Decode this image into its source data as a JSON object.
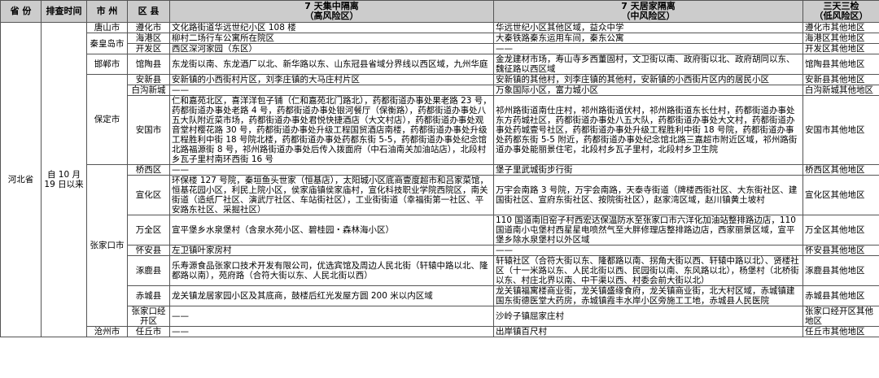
{
  "header": {
    "province": "省 份",
    "date": "排查时间",
    "city": "市 州",
    "county": "区 县",
    "col7_title": "7 天集中隔离",
    "col7_sub": "（高风险区）",
    "col7h_title": "7 天居家隔离",
    "col7h_sub": "（中风险区）",
    "col3_title": "三天三检",
    "col3_sub": "（低风险区）"
  },
  "province": "河北省",
  "date": "自 10 月 19 日以来",
  "cities": {
    "tangshan": "唐山市",
    "qinhuangdao": "秦皇岛市",
    "handan": "邯郸市",
    "baoding": "保定市",
    "zhangjiakou": "张家口市",
    "cangzhou": "沧州市"
  },
  "rows": [
    {
      "county": "遵化市",
      "high": "文化路街道华远世纪小区 108 楼",
      "mid": "华远世纪小区其他区域，益众中学",
      "low": "遵化市其他地区"
    },
    {
      "county": "海港区",
      "high": "柳村二场行车公寓所在院区",
      "mid": "大秦铁路秦东运用车间，秦东公寓",
      "low": "海港区其他地区"
    },
    {
      "county": "开发区",
      "high": "西区深河家园（东区）",
      "mid": "——",
      "low": "开发区其他地区"
    },
    {
      "county": "馆陶县",
      "high": "东龙街以南、东龙酒厂以北、新华路以东、山东冠县省域分界线以西区域，九州华庭",
      "mid": "金龙建材市场，寿山寺乡西董固村，文卫街以南、政府街以北、政府胡同以东、魏征路以西区域",
      "low": "馆陶县其他地区"
    },
    {
      "county": "安新县",
      "high": "安新镇的小西街村片区，刘李庄镇的大马庄村片区",
      "mid": "安新镇的其他村，刘李庄镇的其他村，安新镇的小西街片区内的居民小区",
      "low": "安新县其他地区"
    },
    {
      "county": "白沟新城",
      "high": "——",
      "mid": "万象国际小区，富力城小区",
      "low": "白沟新城其他地区"
    },
    {
      "county": "安国市",
      "high": "仁和嘉苑北区，喜洋洋包子铺（仁和嘉苑北门路北），药都街道办事处果老路 23 号，药都街道办事处老路 4 号，药都街道办事处银河餐厅（保衡路），药都街道办事处八五大队附近菜市场，药都街道办事处君悦快捷酒店（大文村店），药都街道办事处观音堂村樱花路 30 号，药都街道办事处升级工程国贸酒店南楼，药都街道办事处升级工程胜利中街 18 号院北楼，药都街道办事处药都东街 5-5，药都街道办事处纪念馆北路福源街 8 号，祁州路街道办事处后传入拨面府（中石油南关加油站店），北段村乡瓦子里村南环西街 16 号",
      "mid": "祁州路街道南仕庄村，祁州路街道伏村，祁州路街道东长仕村，药都街道办事处东方药城社区，药都街道办事处八五大队，药都街道办事处大文村，药都街道办事处药城壹号社区，药都街道办事处升级工程胜利中街 18 号院，药都街道办事处药都东街 5-5 附近，药都街道办事处纪念馆北路三嘉超市附近区域，祁州路街道办事处能丽景住宅，北段村乡瓦子里村，北段村乡卫生院",
      "low": "安国市其他地区"
    },
    {
      "county": "桥西区",
      "high": "——",
      "mid": "堡子里武城街步行街",
      "low": "桥西区其他地区"
    },
    {
      "county": "宣化区",
      "high": "环保楼 127 号院，秦垣鱼头世家（恒基店），太阳城小区底商壹度超市和吕家菜馆，恒基花园小区，利民上院小区，侯家庙镇侯家庙村，宣化科技职业学院西院区，南关街道（造纸厂社区、演武厅社区、车站街社区），工业街街道（幸福街第一社区、平安路东社区、采掘社区）",
      "mid": "万宇会南路 3 号院，万宇会南路，天泰寺街道（牌楼西街社区、大东街社区、建国街社区、宣府东街社区、按院街社区），赵家湾区域，赵川镇黄土坡村",
      "low": "宣化区其他地区"
    },
    {
      "county": "万全区",
      "high": "宣平堡乡水泉堡村（含泉水苑小区、碧桂园・森林海小区）",
      "mid": "110 国道南旧窑子村西宏达保温防水至张家口市六洋化加油站整排路边店，110 国道南小屯堡村西星星电喷然气至大胖修理店整排路边店，西家丽景区域，宣平堡乡除水泉堡村以外区域",
      "low": "万全区其他地区"
    },
    {
      "county": "怀安县",
      "high": "左卫镇叶家房村",
      "mid": "——",
      "low": "怀安县其他地区"
    },
    {
      "county": "涿鹿县",
      "high": "乐寿源食品张家口技术开发有限公司，优选宾馆及周边人民北街（轩辕中路以北、隆都路以南），苑府路（合符大街以东、人民北街以西）",
      "mid": "轩辕社区（合符大街以东、隆都路以南、拐角大街以西、轩辕中路以北）、贤楼社区（十一米路以东、人民北街以西、民园街以南、东风路以北），杨堡村（北桥街以东、村庄北界以南、中干渠以西、村委会前大街以北）",
      "low": "涿鹿县其他地区"
    },
    {
      "county": "赤城县",
      "high": "龙关镇龙居家园小区及其底商，鼓楼后红光发屋方圆 200 米以内区域",
      "mid": "龙关镇福寓楼商业街，龙关镇盛缘食府，龙关镇商业街，北大村区域，赤城镇建国东街德医堂大药房，赤城镇霞丰水岸小区旁施工工地，赤城县人民医院",
      "low": "赤城县其他地区"
    },
    {
      "county": "张家口经开区",
      "high": "——",
      "mid": "沙岭子镇屈家庄村",
      "low": "张家口经开区其他地区"
    },
    {
      "county": "任丘市",
      "high": "——",
      "mid": "出岸镇百尺村",
      "low": "任丘市其他地区"
    }
  ]
}
